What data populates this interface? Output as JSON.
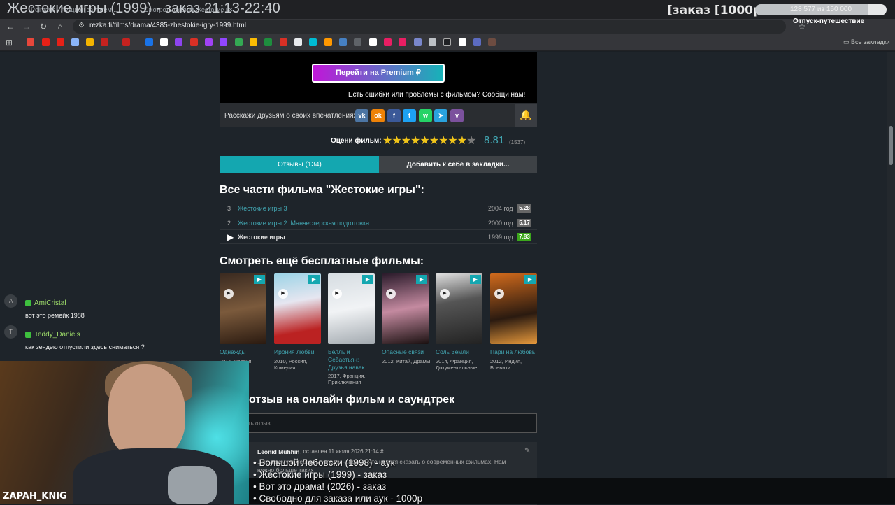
{
  "overlay": {
    "stream_title": "Жестокие игры (1999) - заказ 21:13-22:40",
    "order_price": "[заказ [1000р]",
    "goal_progress_text": "128 577  из 150 000",
    "goal_progress_fraction": 0.857,
    "goal_name": "Отпуск-путешествие",
    "nickname": "ZAPAH_KNIG",
    "queue": [
      "• Большой Лебовски (1998) - аук",
      "• Жестокие игры (1999) - заказ",
      "• Вот это драма! (2026) - заказ",
      "• Свободно для заказа или аук - 1000р"
    ]
  },
  "browser": {
    "tabs": [
      "Pointauc - Аукцион за тотем...",
      "Смотреть фильм Жестокие и..."
    ],
    "url": "rezka.fi/films/drama/4385-zhestokie-igry-1999.html",
    "bookmarks_folder": "Все закладки"
  },
  "page": {
    "premium_button": "Перейти на Premium",
    "report_text": "Есть ошибки или проблемы с фильмом? Сообщи нам!",
    "share_label": "Расскажи друзьям о своих впечатлениях:",
    "social": [
      "vk",
      "ok",
      "f",
      "tw",
      "wa",
      "tg",
      "vb"
    ],
    "rating_label": "Оцени фильм:",
    "rating_value": "8.81",
    "rating_count": "(1537)",
    "stars_filled": 9,
    "stars_total": 10,
    "tab_reviews": "Отзывы (134)",
    "tab_bookmark": "Добавить к себе в закладки...",
    "parts_heading": "Все части фильма \"Жестокие игры\":",
    "parts": [
      {
        "num": "3",
        "title": "Жестокие игры 3",
        "year": "2004 год",
        "score": "5.28",
        "color": "#666666"
      },
      {
        "num": "2",
        "title": "Жестокие игры 2: Манчестерская подготовка",
        "year": "2000 год",
        "score": "5.17",
        "color": "#666666"
      },
      {
        "num": "▶",
        "title": "Жестокие игры",
        "year": "1999 год",
        "score": "7.83",
        "color": "#3ca71c"
      }
    ],
    "free_heading": "Смотреть ещё бесплатные фильмы:",
    "films": [
      {
        "title": "Однажды",
        "meta": "2015, Россия,"
      },
      {
        "title": "Ирония любви",
        "meta": "2010, Россия, Комедия"
      },
      {
        "title": "Белль и Себастьян: Друзья навек",
        "meta": "2017, Франция, Приключения"
      },
      {
        "title": "Опасные связи",
        "meta": "2012, Китай, Драмы"
      },
      {
        "title": "Соль Земли",
        "meta": "2014, Франция, Документальные"
      },
      {
        "title": "Пари на любовь",
        "meta": "2012, Индия, Боевики"
      }
    ],
    "review_heading": "отзыв на онлайн фильм и саундтрек",
    "review_placeholder": "ть отзыв",
    "comment_author": "Leonid Muhhin",
    "comment_meta": ", оставлен 11 июля 2026 21:14 #",
    "comment_text": "...по-моему интересны и полезны для ...что нельзя сказать о современных фильмах. Нам нужно больше таких"
  },
  "chat": [
    {
      "avatar": "A",
      "name": "AmiCristal",
      "message": "вот это ремейк 1988"
    },
    {
      "avatar": "T",
      "name": "Teddy_Daniels",
      "message": "как зендею отпустили здесь сниматься ?"
    }
  ]
}
